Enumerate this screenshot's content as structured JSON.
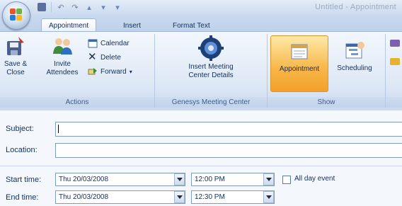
{
  "window": {
    "title": "Untitled - Appointment"
  },
  "tabs": [
    {
      "label": "Appointment",
      "active": true
    },
    {
      "label": "Insert",
      "active": false
    },
    {
      "label": "Format Text",
      "active": false
    }
  ],
  "ribbon": {
    "actions": {
      "label": "Actions",
      "save_close": [
        "Save &",
        "Close"
      ],
      "invite": [
        "Invite",
        "Attendees"
      ],
      "calendar": "Calendar",
      "delete": "Delete",
      "forward": "Forward"
    },
    "genesys": {
      "label": "Genesys Meeting Center",
      "insert": [
        "Insert Meeting",
        "Center Details"
      ]
    },
    "show": {
      "label": "Show",
      "appointment": "Appointment",
      "scheduling": "Scheduling"
    }
  },
  "form": {
    "subject_label": "Subject:",
    "location_label": "Location:",
    "start_label": "Start time:",
    "end_label": "End time:",
    "start_date": "Thu 20/03/2008",
    "start_time": "12:00 PM",
    "end_date": "Thu 20/03/2008",
    "end_time": "12:30 PM",
    "all_day_label": "All day event",
    "all_day_checked": false
  },
  "colors": {
    "ribbon_bg": "#dde8f6",
    "selected_button": "#f7b648",
    "text": "#15305a"
  },
  "icons": [
    "office-button-icon",
    "save-icon",
    "undo-icon",
    "redo-icon",
    "save-close-icon",
    "invite-attendees-icon",
    "calendar-icon",
    "delete-icon",
    "forward-icon",
    "meeting-center-icon",
    "appointment-icon",
    "scheduling-icon"
  ]
}
